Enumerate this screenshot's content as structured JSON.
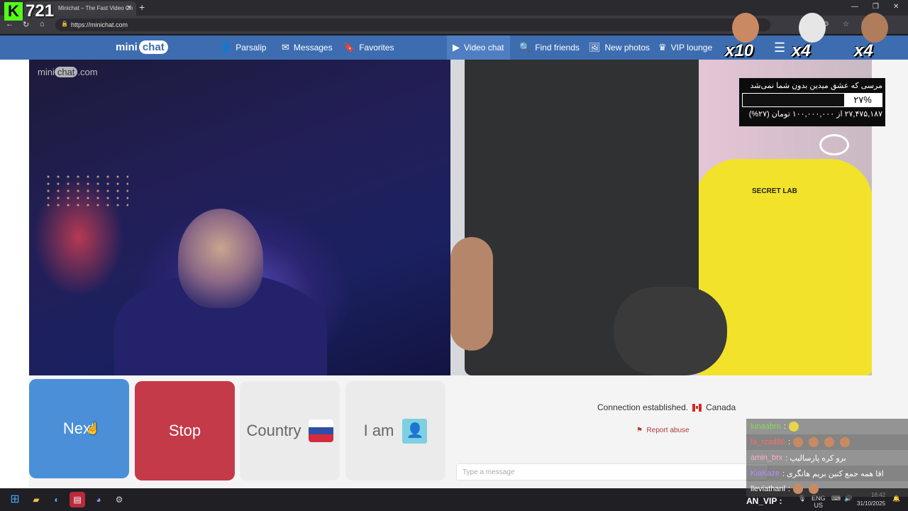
{
  "browser": {
    "tab_title": "Minichat – The Fast Video Ch",
    "url": "https://minichat.com"
  },
  "overlay": {
    "viewer_count": "721",
    "emotes": [
      {
        "name": "emote-face-1",
        "multiplier": "x10"
      },
      {
        "name": "emote-face-2",
        "multiplier": "x4"
      },
      {
        "name": "emote-face-3",
        "multiplier": "x4"
      }
    ],
    "donation": {
      "title": "مرسی که عشق میدین بدون شما نمی‌شد",
      "percent_label": "۲۷%",
      "progress": 0.27,
      "subtitle": "۲۷,۴۷۵,۱۸۷ از ۱۰۰,۰۰۰,۰۰۰ تومان (۲۷%)"
    }
  },
  "site": {
    "logo_a": "mini",
    "logo_b": "chat",
    "nav": [
      {
        "label": "Parsalip",
        "icon": "avatar-icon"
      },
      {
        "label": "Messages",
        "icon": "envelope-icon"
      },
      {
        "label": "Favorites",
        "icon": "bookmark-icon"
      },
      {
        "label": "Video chat",
        "icon": "video-icon"
      },
      {
        "label": "Find friends",
        "icon": "search-icon"
      },
      {
        "label": "New photos",
        "icon": "photos-icon"
      },
      {
        "label": "VIP lounge",
        "icon": "crown-icon"
      }
    ],
    "watermark": "minichat.com"
  },
  "controls": {
    "next": "Next",
    "stop": "Stop",
    "country": "Country",
    "iam": "I am"
  },
  "chat": {
    "connection": "Connection established.",
    "country": "Canada",
    "report": "Report abuse",
    "placeholder": "Type a message"
  },
  "kick_chat": [
    {
      "user": "lunaabrn",
      "text": ":",
      "color": "#7ee04f"
    },
    {
      "user": "fa_rzad86",
      "text": ":",
      "color": "#ff6b6b"
    },
    {
      "user": "amin_brx",
      "text": ": برو کره پارسالیپ",
      "color": "#ffb0c0"
    },
    {
      "user": "KiaKaze",
      "text": ": اقا همه جمع کنین بریم هانگری",
      "color": "#b48cff"
    },
    {
      "user": "lleviathanl",
      "text": ":",
      "color": "#ffffff"
    }
  ],
  "taskbar": {
    "vip_label": "AN_VIP :",
    "lang": "ENG",
    "lang_sub": "US",
    "time": "16:42",
    "date": "31/10/2025"
  },
  "colors": {
    "header": "#3d6db0",
    "next": "#4a8fd8",
    "stop": "#c43a49",
    "kick_green": "#53fc18"
  }
}
